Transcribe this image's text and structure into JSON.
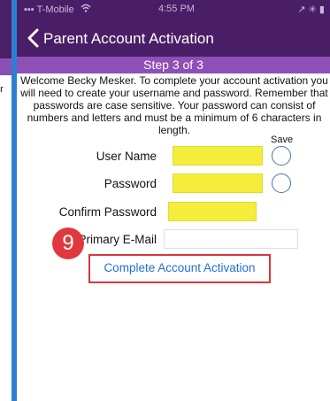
{
  "left_screen": {
    "partial_text": "er"
  },
  "status_bar": {
    "carrier": "T-Mobile",
    "wifi": "wifi-icon",
    "time": "4:55 PM",
    "right_icons": "↗ ✳ ▮"
  },
  "nav": {
    "back_icon": "chevron-left-icon",
    "title": "Parent Account Activation"
  },
  "step": {
    "label": "Step 3 of 3"
  },
  "intro": {
    "lines": [
      "Welcome Becky Mesker. To complete your account activation you",
      "will need to create your username and password. Remember that",
      "passwords are case sensitive. Your password can consist of",
      "numbers and letters and must be a minimum of 6 characters in",
      "length."
    ]
  },
  "form": {
    "save_header": "Save",
    "username_label": "User Name",
    "password_label": "Password",
    "confirm_label": "Confirm Password",
    "email_label": "Primary E-Mail"
  },
  "badge": {
    "number": "9",
    "color": "#e0383e"
  },
  "action": {
    "label": "Complete Account Activation"
  },
  "colors": {
    "header": "#4a1e66",
    "step_band": "#8e4fb6",
    "highlight_field": "#f5ed3b",
    "link": "#1f6fd6",
    "background": "#2f7fd0"
  }
}
